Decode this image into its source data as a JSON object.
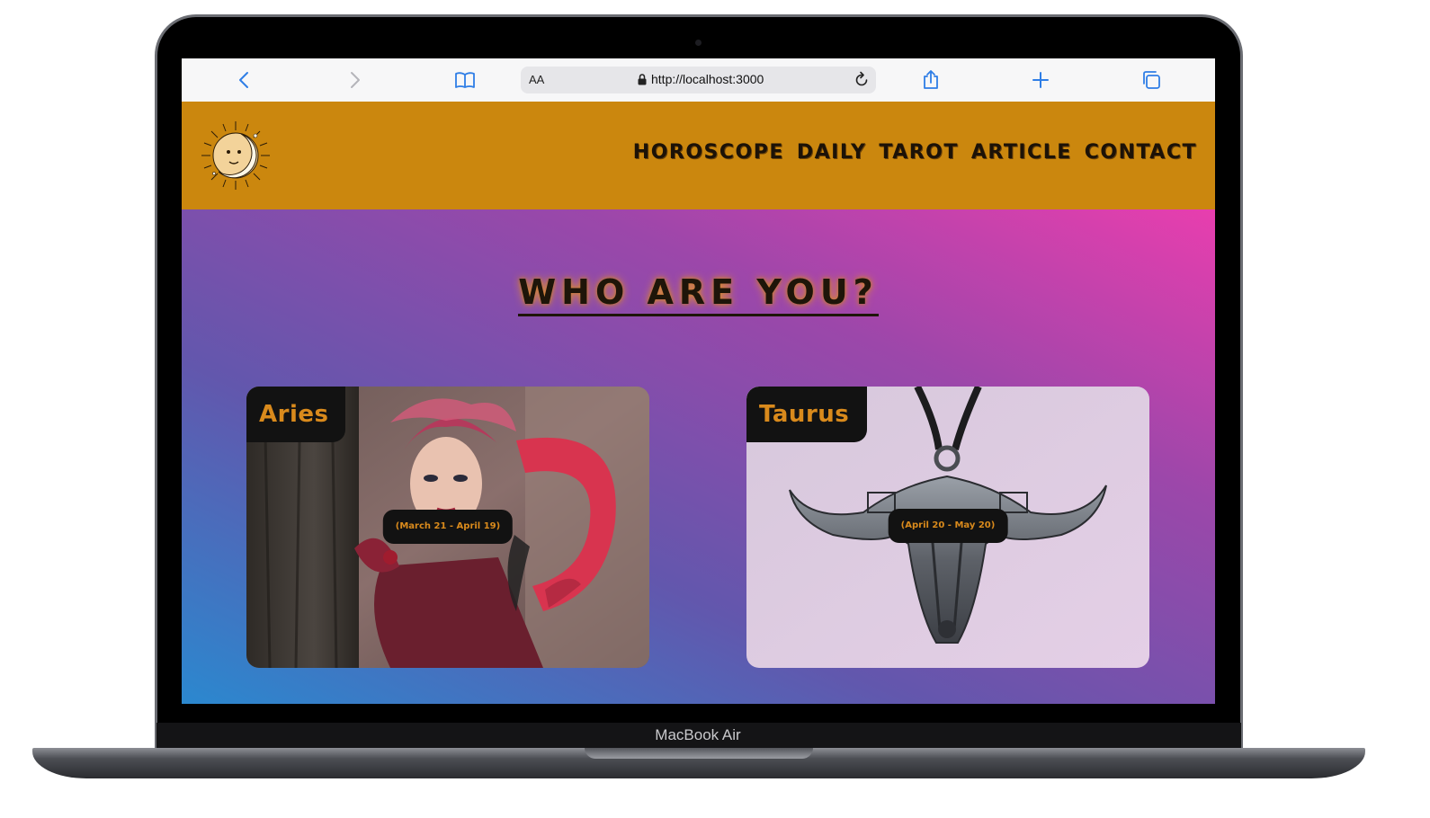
{
  "device": {
    "label": "MacBook Air"
  },
  "browser": {
    "aa_label": "AA",
    "url": "http://localhost:3000"
  },
  "site": {
    "nav": [
      "HOROSCOPE",
      "DAILY",
      "TAROT",
      "ARTICLE",
      "CONTACT"
    ],
    "hero_title": "WHO ARE YOU?",
    "cards": [
      {
        "name": "Aries",
        "dates": "(March 21 - April 19)"
      },
      {
        "name": "Taurus",
        "dates": "(April 20 - May 20)"
      }
    ]
  },
  "colors": {
    "header_bg": "#cb870e",
    "accent_text": "#d98a1c",
    "label_bg": "#121212",
    "browser_icon": "#2f7ee6"
  },
  "icons": [
    "back-icon",
    "forward-icon",
    "bookmarks-icon",
    "lock-icon",
    "reload-icon",
    "share-icon",
    "new-tab-icon",
    "tabs-icon",
    "sun-moon-logo"
  ]
}
